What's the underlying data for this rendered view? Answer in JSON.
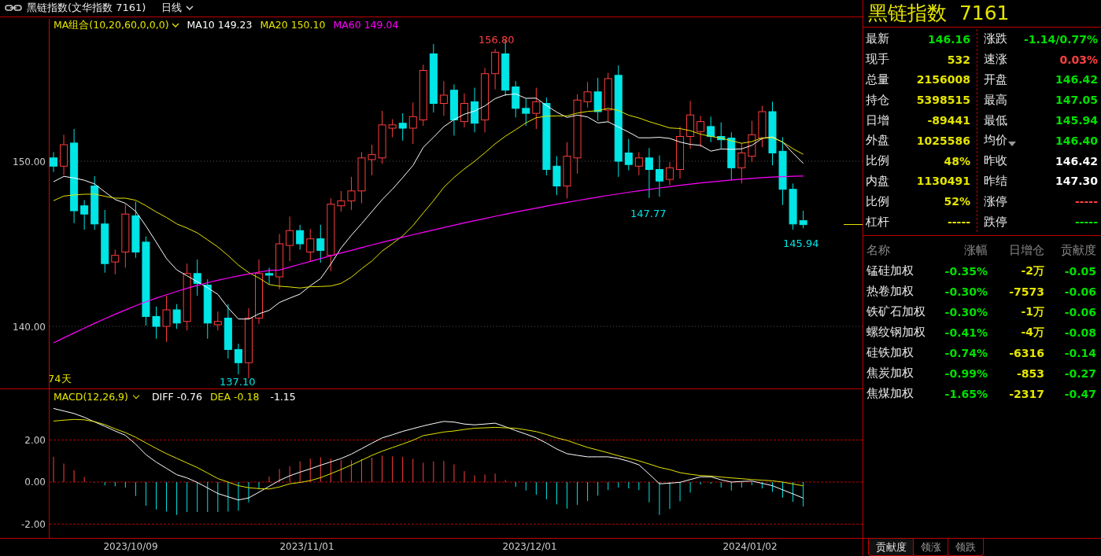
{
  "header": {
    "title": "黑链指数(文华指数 7161)",
    "period": "日线"
  },
  "main_chart": {
    "ma_label": "MA组合(10,20,60,0,0,0)",
    "ma_items": [
      {
        "text": "MA10 149.23",
        "color": "#ffffff"
      },
      {
        "text": "MA20 150.10",
        "color": "#e5e500"
      },
      {
        "text": "MA60 149.04",
        "color": "#ff00ff"
      }
    ],
    "y_labels": [
      "150.00",
      "140.00"
    ],
    "price_marks": [
      {
        "text": "156.80",
        "color": "#ff4040"
      },
      {
        "text": "147.77",
        "color": "#00e5e5"
      },
      {
        "text": "145.94",
        "color": "#00e5e5"
      },
      {
        "text": "137.10",
        "color": "#00e5e5"
      }
    ],
    "days": "74天"
  },
  "macd": {
    "label": "MACD(12,26,9)",
    "series_values": [
      "-0.76",
      "-0.18"
    ],
    "histogram_value": "-1.15",
    "chart_data": {
      "type": "line",
      "grid": true,
      "ylim": [
        -2.69,
        4.41
      ],
      "yticks": [
        {
          "value": 2,
          "label": "2.00"
        },
        {
          "value": 0,
          "label": "0.00"
        },
        {
          "value": -2,
          "label": "-2.00"
        }
      ],
      "series": [
        {
          "name": "DIFF",
          "color": "#ffffff",
          "values": [
            3.5,
            3.38,
            3.26,
            3.08,
            2.86,
            2.65,
            2.43,
            2.22,
            1.8,
            1.3,
            0.95,
            0.65,
            0.35,
            0.2,
            -0.02,
            -0.28,
            -0.54,
            -0.7,
            -0.85,
            -0.75,
            -0.48,
            -0.2,
            0.08,
            0.3,
            0.47,
            0.63,
            0.8,
            0.96,
            1.12,
            1.33,
            1.59,
            1.85,
            2.1,
            2.25,
            2.41,
            2.54,
            2.67,
            2.78,
            2.88,
            2.85,
            2.76,
            2.72,
            2.76,
            2.8,
            2.63,
            2.45,
            2.28,
            2.1,
            1.85,
            1.57,
            1.35,
            1.27,
            1.2,
            1.2,
            1.2,
            1.12,
            0.99,
            0.82,
            0.38,
            -0.08,
            -0.05,
            -0.01,
            0.12,
            0.25,
            0.25,
            0.11,
            0.0,
            0.03,
            0.05,
            -0.06,
            -0.17,
            -0.37,
            -0.56,
            -0.76
          ]
        },
        {
          "name": "DEA",
          "color": "#e5e500",
          "values": [
            2.9,
            2.94,
            2.98,
            2.96,
            2.87,
            2.73,
            2.53,
            2.35,
            2.13,
            1.86,
            1.6,
            1.35,
            1.13,
            0.91,
            0.69,
            0.43,
            0.17,
            0.0,
            -0.17,
            -0.27,
            -0.31,
            -0.33,
            -0.23,
            -0.08,
            -0.02,
            0.07,
            0.21,
            0.4,
            0.6,
            0.81,
            1.04,
            1.27,
            1.47,
            1.64,
            1.81,
            1.99,
            2.21,
            2.29,
            2.38,
            2.43,
            2.5,
            2.56,
            2.58,
            2.6,
            2.58,
            2.56,
            2.48,
            2.4,
            2.26,
            2.1,
            1.98,
            1.81,
            1.65,
            1.52,
            1.39,
            1.25,
            1.14,
            1.01,
            0.86,
            0.7,
            0.59,
            0.45,
            0.37,
            0.31,
            0.29,
            0.24,
            0.2,
            0.16,
            0.12,
            0.09,
            0.06,
            0.0,
            -0.09,
            -0.18
          ]
        }
      ]
    }
  },
  "x_labels": [
    "2023/10/09",
    "2023/11/01",
    "2023/12/01",
    "2024/01/02"
  ],
  "quote": {
    "title": "黑链指数  7161",
    "left": [
      {
        "label": "最新",
        "value": "146.16",
        "color": "#00e000"
      },
      {
        "label": "现手",
        "value": "532",
        "color": "#e5e500"
      },
      {
        "label": "总量",
        "value": "2156008",
        "color": "#e5e500"
      },
      {
        "label": "持仓",
        "value": "5398515",
        "color": "#e5e500"
      },
      {
        "label": "日增",
        "value": "-89441",
        "color": "#e5e500"
      },
      {
        "label": "外盘",
        "value": "1025586",
        "color": "#e5e500"
      },
      {
        "label": "比例",
        "value": "48%",
        "color": "#e5e500"
      },
      {
        "label": "内盘",
        "value": "1130491",
        "color": "#e5e500"
      },
      {
        "label": "比例",
        "value": "52%",
        "color": "#e5e500"
      },
      {
        "label": "杠杆",
        "value": "-----",
        "color": "#e5e500"
      }
    ],
    "right": [
      {
        "label": "涨跌",
        "value": "-1.14/0.77%",
        "color": "#00e000",
        "dropdown": false
      },
      {
        "label": "速涨",
        "value": "0.03%",
        "color": "#ff4040",
        "dropdown": false
      },
      {
        "label": "开盘",
        "value": "146.42",
        "color": "#00e000",
        "dropdown": false
      },
      {
        "label": "最高",
        "value": "147.05",
        "color": "#00e000",
        "dropdown": false
      },
      {
        "label": "最低",
        "value": "145.94",
        "color": "#00e000",
        "dropdown": false
      },
      {
        "label": "均价",
        "value": "146.40",
        "color": "#00e000",
        "dropdown": true
      },
      {
        "label": "昨收",
        "value": "146.42",
        "color": "#ffffff",
        "dropdown": false
      },
      {
        "label": "昨结",
        "value": "147.30",
        "color": "#ffffff",
        "dropdown": false
      },
      {
        "label": "涨停",
        "value": "-----",
        "color": "#ff4040",
        "dropdown": false
      },
      {
        "label": "跌停",
        "value": "-----",
        "color": "#00e000",
        "dropdown": false
      }
    ]
  },
  "constituents": {
    "columns": [
      "名称",
      "涨幅",
      "日增仓",
      "贡献度"
    ],
    "rows": [
      {
        "name": "锰硅加权",
        "change": "-0.35%",
        "oi_change": "-2万",
        "contribution": "-0.05"
      },
      {
        "name": "热卷加权",
        "change": "-0.30%",
        "oi_change": "-7573",
        "contribution": "-0.06"
      },
      {
        "name": "铁矿石加权",
        "change": "-0.30%",
        "oi_change": "-1万",
        "contribution": "-0.06"
      },
      {
        "name": "螺纹钢加权",
        "change": "-0.41%",
        "oi_change": "-4万",
        "contribution": "-0.08"
      },
      {
        "name": "硅铁加权",
        "change": "-0.74%",
        "oi_change": "-6316",
        "contribution": "-0.14"
      },
      {
        "name": "焦炭加权",
        "change": "-0.99%",
        "oi_change": "-853",
        "contribution": "-0.27"
      },
      {
        "name": "焦煤加权",
        "change": "-1.65%",
        "oi_change": "-2317",
        "contribution": "-0.47"
      }
    ]
  },
  "tabs": [
    {
      "label": "贡献度",
      "selected": true
    },
    {
      "label": "领涨",
      "selected": false
    },
    {
      "label": "领跌",
      "selected": false
    }
  ]
}
